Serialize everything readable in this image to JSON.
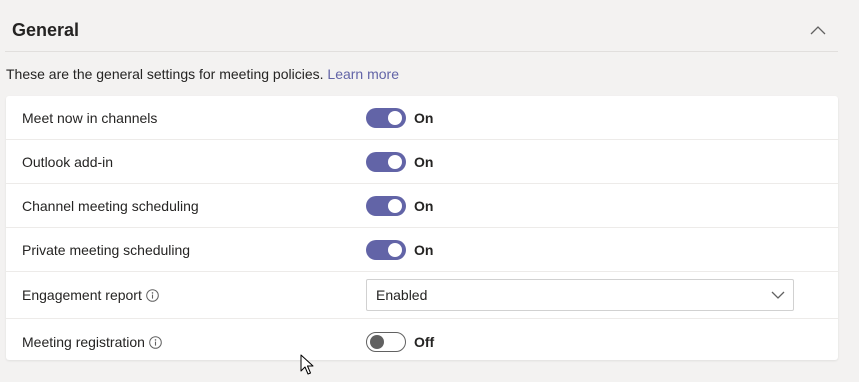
{
  "section": {
    "title": "General",
    "description": "These are the general settings for meeting policies.",
    "learn_more": "Learn more"
  },
  "settings": [
    {
      "label": "Meet now in channels",
      "type": "toggle",
      "state": "On",
      "enabled": true
    },
    {
      "label": "Outlook add-in",
      "type": "toggle",
      "state": "On",
      "enabled": true
    },
    {
      "label": "Channel meeting scheduling",
      "type": "toggle",
      "state": "On",
      "enabled": true
    },
    {
      "label": "Private meeting scheduling",
      "type": "toggle",
      "state": "On",
      "enabled": true
    },
    {
      "label": "Engagement report",
      "type": "dropdown",
      "value": "Enabled",
      "info_icon": true
    },
    {
      "label": "Meeting registration",
      "type": "toggle",
      "state": "Off",
      "enabled": false,
      "info_icon": true
    }
  ],
  "colors": {
    "accent": "#6264a7",
    "background": "#f3f2f1",
    "card": "#ffffff"
  },
  "icons": {
    "collapse": "chevron-up-icon",
    "dropdown": "chevron-down-icon",
    "info": "info-icon",
    "pointer": "mouse-cursor-icon"
  }
}
